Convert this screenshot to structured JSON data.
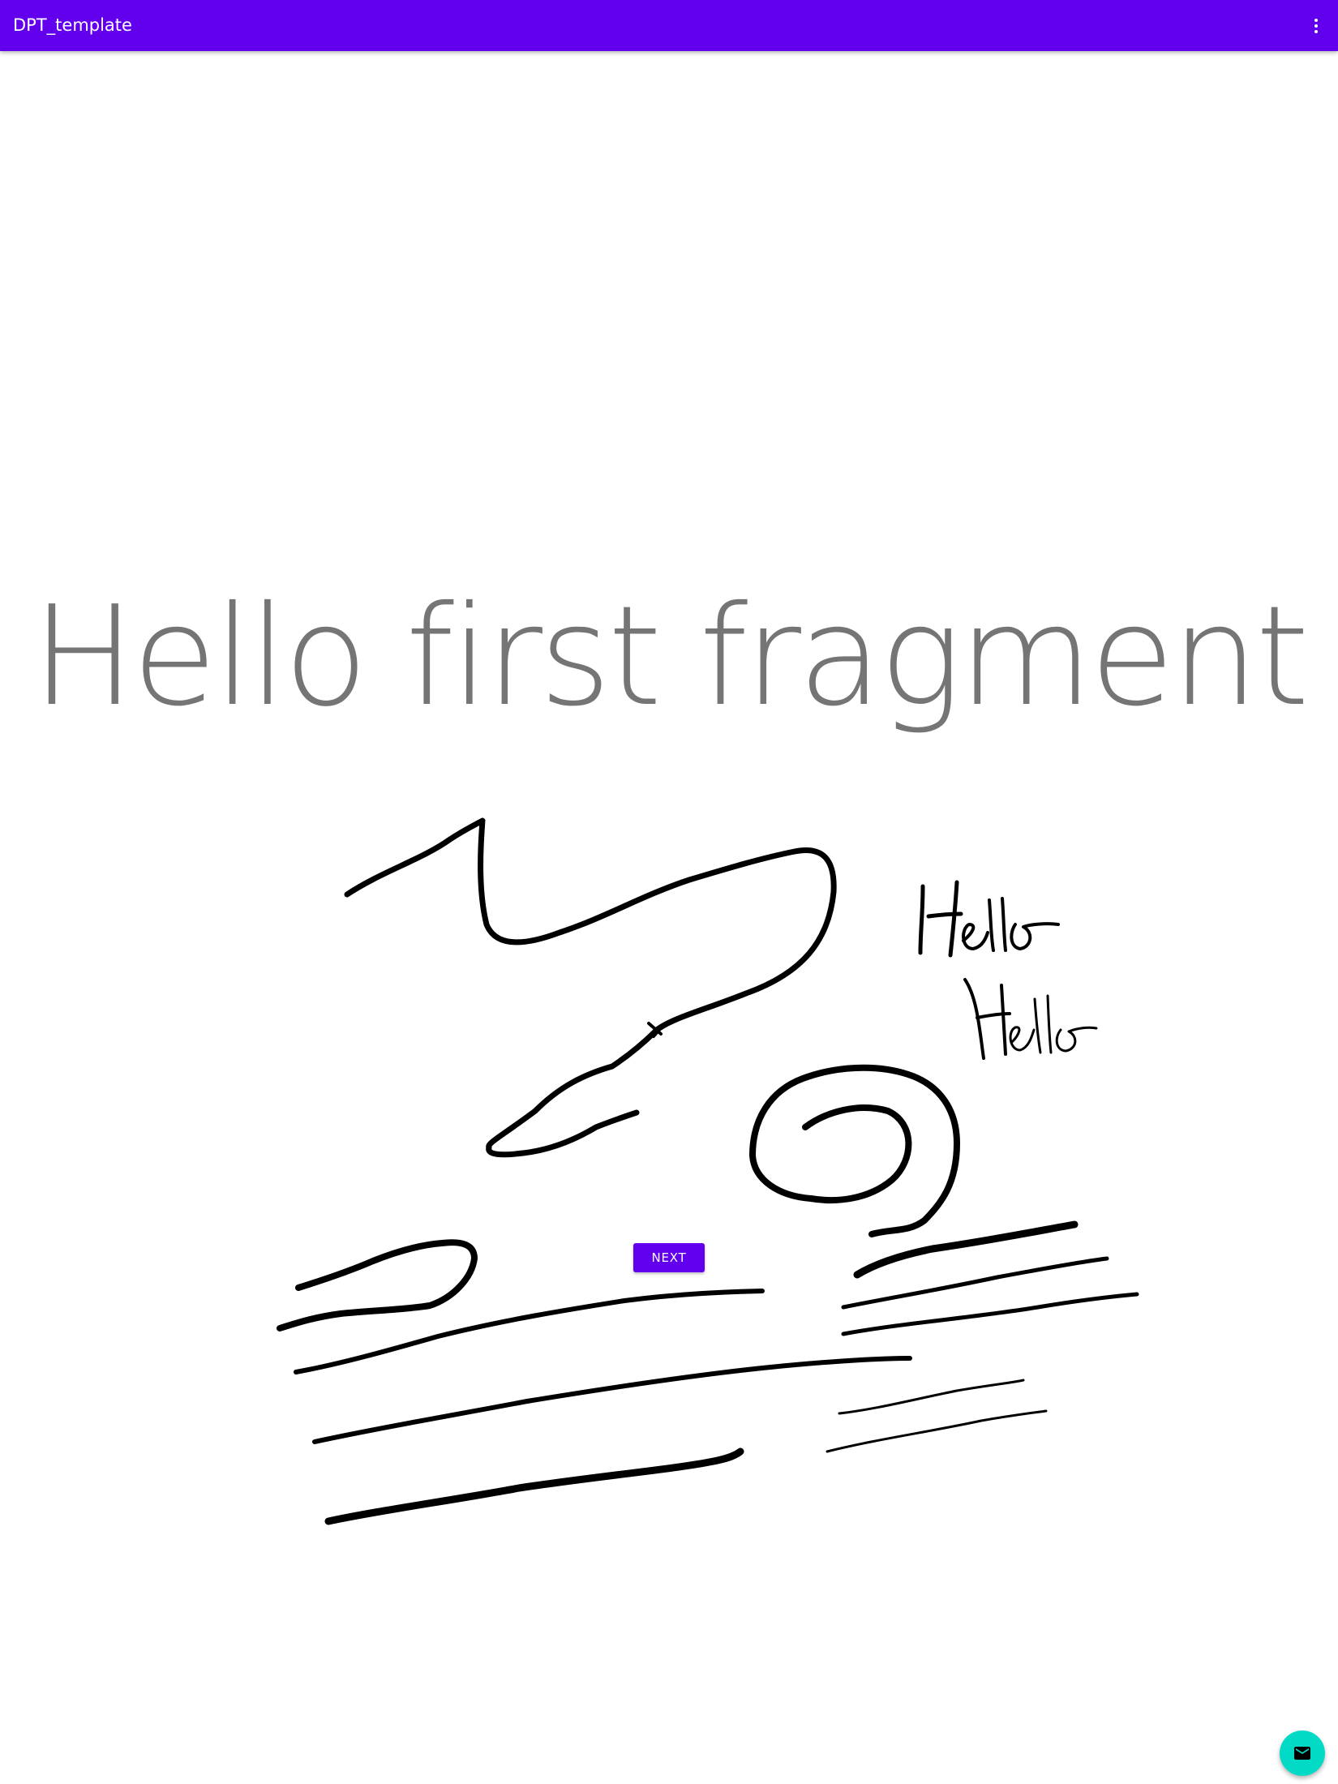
{
  "app_bar": {
    "title": "DPT_template",
    "menu_icon": "more-vert-icon",
    "color": "#6200ee"
  },
  "main": {
    "heading": "Hello first fragment",
    "heading_color": "#757575",
    "next_button_label": "NEXT",
    "next_button_color": "#6200ee"
  },
  "drawing": {
    "handwritten_words": [
      "Hello",
      "Hello"
    ],
    "stroke_color": "#000000"
  },
  "fab": {
    "icon": "email-icon",
    "color": "#03dac5"
  }
}
